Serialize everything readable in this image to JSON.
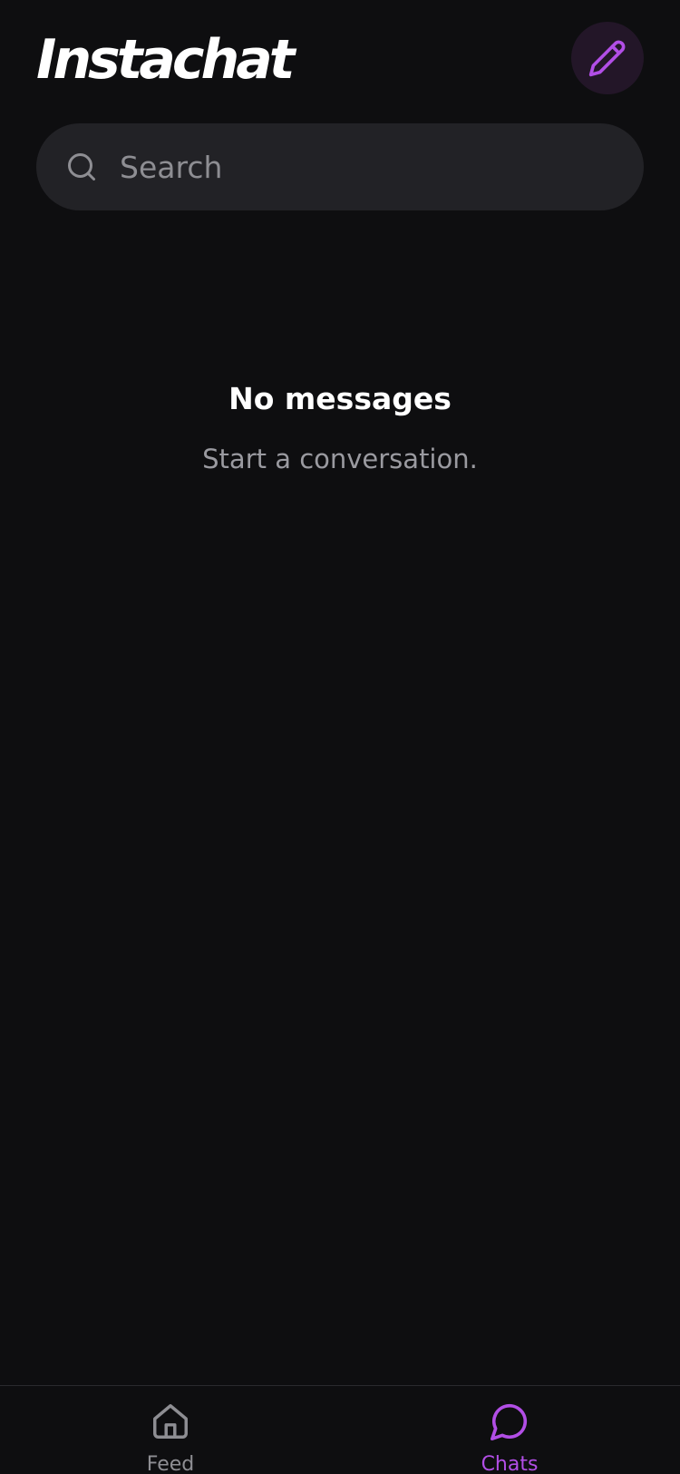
{
  "app": {
    "title": "Instachat"
  },
  "header": {
    "compose_icon": "pencil-icon"
  },
  "search": {
    "placeholder": "Search",
    "value": "",
    "icon": "search-icon"
  },
  "empty_state": {
    "title": "No messages",
    "subtitle": "Start a conversation."
  },
  "bottom_nav": {
    "items": [
      {
        "label": "Feed",
        "icon": "home-icon",
        "active": false
      },
      {
        "label": "Chats",
        "icon": "chat-bubble-icon",
        "active": true
      }
    ]
  },
  "colors": {
    "background": "#0e0e10",
    "accent": "#b24ee6",
    "search_bg": "#222226",
    "compose_bg": "#231628",
    "muted_text": "#9a9aa0"
  }
}
